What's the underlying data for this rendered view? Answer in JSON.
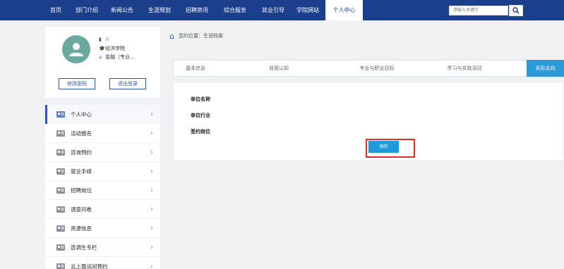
{
  "nav": {
    "items": [
      "首页",
      "部门介绍",
      "新闻公告",
      "生涯规划",
      "招聘资讯",
      "综合服务",
      "就业引导",
      "学院网站",
      "个人中心"
    ],
    "active_index": 8,
    "search_placeholder": "请输入关键字"
  },
  "profile": {
    "name": "ill",
    "college": "经济学院",
    "major": "金融（专业...",
    "edit_password": "修改密码",
    "logout": "退出登录"
  },
  "menu": {
    "items": [
      {
        "label": "个人中心",
        "active": true
      },
      {
        "label": "活动报名",
        "active": false
      },
      {
        "label": "咨询预约",
        "active": false
      },
      {
        "label": "就业手续",
        "active": false
      },
      {
        "label": "招聘岗位",
        "active": false
      },
      {
        "label": "调查问卷",
        "active": false
      },
      {
        "label": "资源信息",
        "active": false
      },
      {
        "label": "选调生专栏",
        "active": false
      },
      {
        "label": "云上面试间预约",
        "active": false
      }
    ]
  },
  "breadcrumb": {
    "prefix": "您的位置：",
    "current": "生涯档案"
  },
  "tabs": {
    "items": [
      "基本信息",
      "自我认知",
      "专业与职业目标",
      "学习与实践活动",
      "实际去向"
    ],
    "active_index": 4
  },
  "form": {
    "fields": [
      "单位名称",
      "单位行业",
      "签约岗位"
    ],
    "save_label": "保存"
  },
  "colors": {
    "nav_bg": "#1c3f8c",
    "accent": "#2c9ad9",
    "highlight": "#d9302c"
  }
}
